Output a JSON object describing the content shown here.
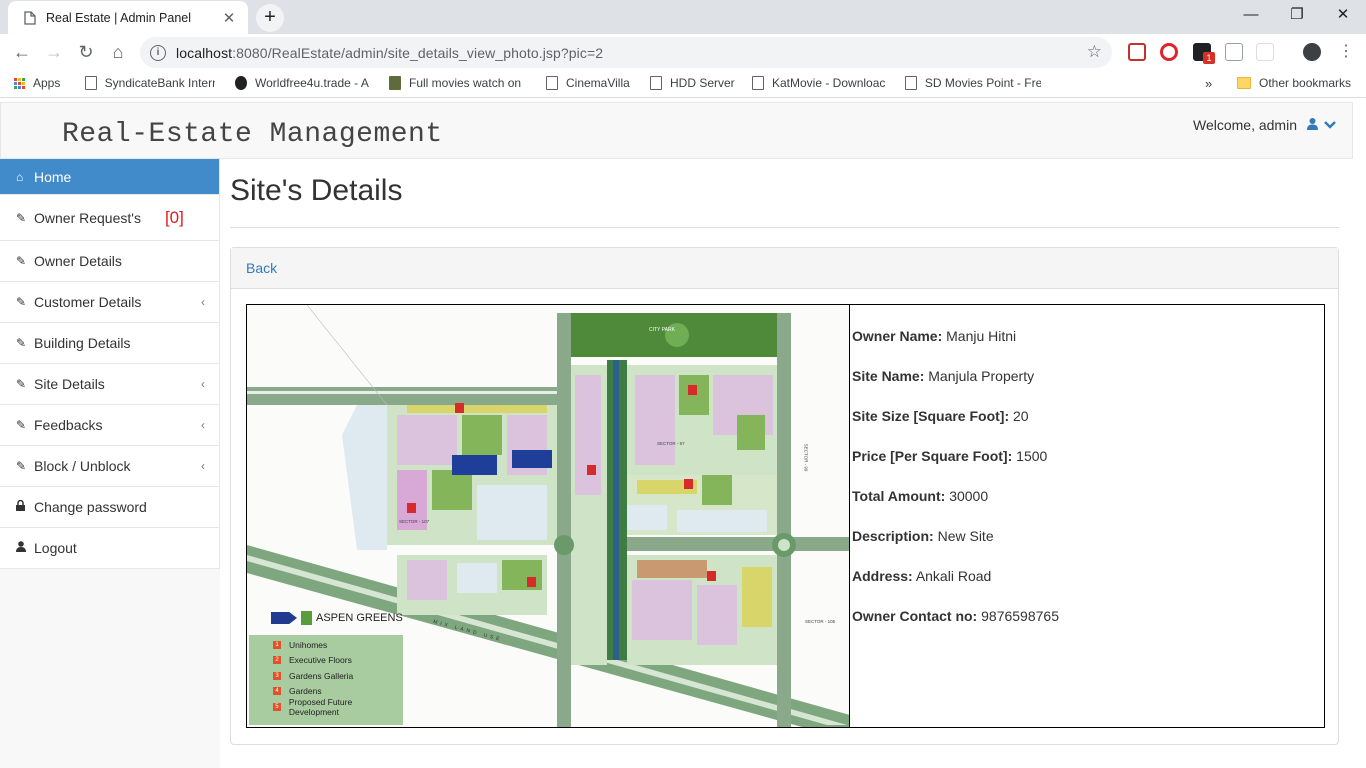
{
  "browser": {
    "tab_title": "Real Estate | Admin Panel",
    "url_host": "localhost",
    "url_path": ":8080/RealEstate/admin/site_details_view_photo.jsp?pic=2",
    "bookmarks": [
      {
        "label": "Apps"
      },
      {
        "label": "SyndicateBank Intern"
      },
      {
        "label": "Worldfree4u.trade - A"
      },
      {
        "label": "Full movies watch on"
      },
      {
        "label": "CinemaVilla"
      },
      {
        "label": "HDD Server"
      },
      {
        "label": "KatMovie - Downloac"
      },
      {
        "label": "SD Movies Point - Fre"
      }
    ],
    "other_bookmarks": "Other bookmarks",
    "overflow": "»",
    "ext_badge": "1"
  },
  "app": {
    "brand": "Real-Estate Management",
    "welcome": "Welcome, admin"
  },
  "sidebar": {
    "items": [
      {
        "label": "Home"
      },
      {
        "label": "Owner Request's",
        "badge": "[0]"
      },
      {
        "label": "Owner Details"
      },
      {
        "label": "Customer Details"
      },
      {
        "label": "Building Details"
      },
      {
        "label": "Site Details"
      },
      {
        "label": "Feedbacks"
      },
      {
        "label": "Block / Unblock"
      },
      {
        "label": "Change password"
      },
      {
        "label": "Logout"
      }
    ]
  },
  "page": {
    "title": "Site's Details",
    "back_link": "Back"
  },
  "details": {
    "owner_name_label": "Owner Name:",
    "owner_name": "Manju Hitni",
    "site_name_label": "Site Name:",
    "site_name": "Manjula Property",
    "site_size_label": "Site Size [Square Foot]:",
    "site_size": "20",
    "price_label": "Price [Per Square Foot]:",
    "price": "1500",
    "total_label": "Total Amount:",
    "total": "30000",
    "description_label": "Description:",
    "description": "New Site",
    "address_label": "Address:",
    "address": "Ankali Road",
    "contact_label": "Owner Contact no:",
    "contact": "9876598765"
  },
  "map": {
    "brand": "ASPEN GREENS",
    "legend": [
      {
        "num": "1",
        "label": "Unihomes"
      },
      {
        "num": "2",
        "label": "Executive Floors"
      },
      {
        "num": "3",
        "label": "Gardens Galleria"
      },
      {
        "num": "4",
        "label": "Gardens"
      },
      {
        "num": "5",
        "label": "Proposed Future Development"
      }
    ],
    "labels": {
      "city_park": "CITY PARK",
      "sector_97": "SECTOR - 97",
      "sector_107": "SECTOR - 107",
      "sector_105": "SECTOR - 105",
      "sector_99": "SECTOR - 99",
      "mix_land_use": "MIX LAND USE"
    }
  }
}
